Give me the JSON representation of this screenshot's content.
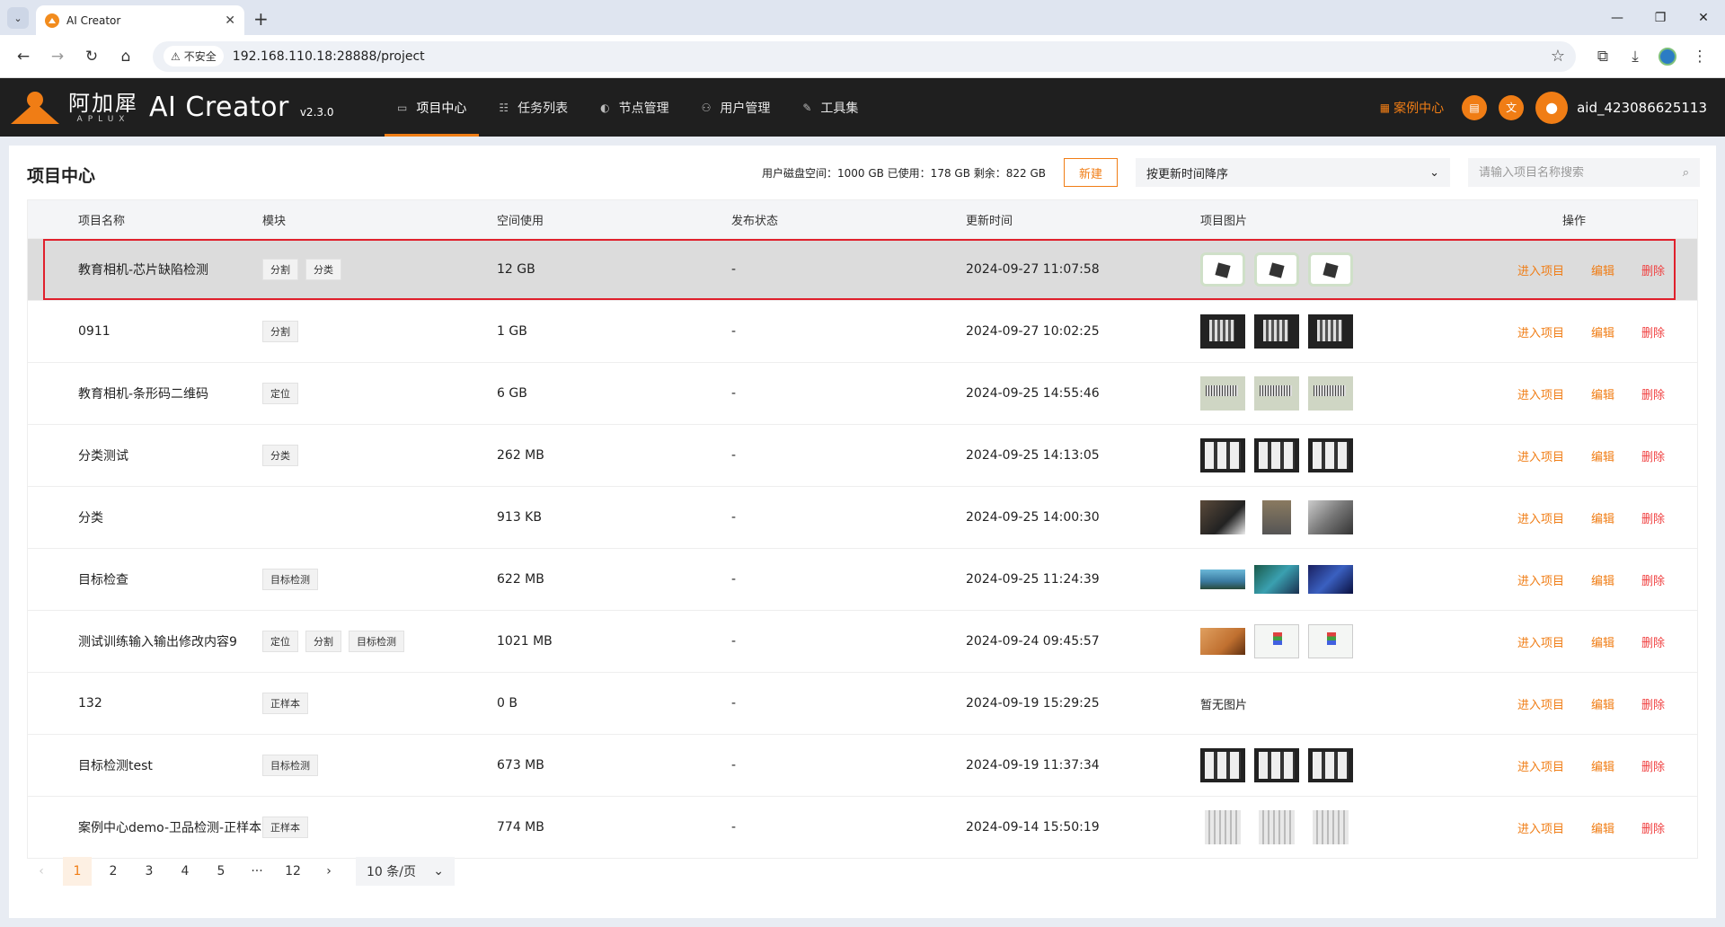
{
  "browser": {
    "tab_title": "AI Creator",
    "insecure_label": "不安全",
    "url": "192.168.110.18:28888/project"
  },
  "app": {
    "logo_cn": "阿加犀",
    "logo_en": "APLUX",
    "name": "AI Creator",
    "version": "v2.3.0",
    "nav": [
      {
        "label": "项目中心",
        "icon": "project-icon"
      },
      {
        "label": "任务列表",
        "icon": "list-icon"
      },
      {
        "label": "节点管理",
        "icon": "node-icon"
      },
      {
        "label": "用户管理",
        "icon": "users-icon"
      },
      {
        "label": "工具集",
        "icon": "tool-icon"
      }
    ],
    "case_center": "案例中心",
    "user": "aid_423086625113"
  },
  "page": {
    "title": "项目中心",
    "disk_info": "用户磁盘空间：1000 GB 已使用：178 GB 剩余：822 GB",
    "new_button": "新建",
    "sort_value": "按更新时间降序",
    "search_placeholder": "请输入项目名称搜索"
  },
  "table": {
    "headers": [
      "项目名称",
      "模块",
      "空间使用",
      "发布状态",
      "更新时间",
      "项目图片",
      "操作"
    ],
    "ops": {
      "enter": "进入项目",
      "edit": "编辑",
      "delete": "删除"
    },
    "no_image": "暂无图片",
    "rows": [
      {
        "name": "教育相机-芯片缺陷检测",
        "modules": [
          "分割",
          "分类"
        ],
        "space": "12 GB",
        "status": "-",
        "time": "2024-09-27 11:07:58",
        "thumb": "t-chip",
        "selected": true
      },
      {
        "name": "0911",
        "modules": [
          "分割"
        ],
        "space": "1 GB",
        "status": "-",
        "time": "2024-09-27 10:02:25",
        "thumb": "t-dark"
      },
      {
        "name": "教育相机-条形码二维码",
        "modules": [
          "定位"
        ],
        "space": "6 GB",
        "status": "-",
        "time": "2024-09-25 14:55:46",
        "thumb": "t-bar"
      },
      {
        "name": "分类测试",
        "modules": [
          "分类"
        ],
        "space": "262 MB",
        "status": "-",
        "time": "2024-09-25 14:13:05",
        "thumb": "t-sw"
      },
      {
        "name": "分类",
        "modules": [],
        "space": "913 KB",
        "status": "-",
        "time": "2024-09-25 14:00:30",
        "thumb": "cats"
      },
      {
        "name": "目标检查",
        "modules": [
          "目标检测"
        ],
        "space": "622 MB",
        "status": "-",
        "time": "2024-09-25 11:24:39",
        "thumb": "games"
      },
      {
        "name": "测试训练输入输出修改内容9",
        "modules": [
          "定位",
          "分割",
          "目标检测"
        ],
        "space": "1021 MB",
        "status": "-",
        "time": "2024-09-24 09:45:57",
        "thumb": "mixed"
      },
      {
        "name": "132",
        "modules": [
          "正样本"
        ],
        "space": "0 B",
        "status": "-",
        "time": "2024-09-19 15:29:25",
        "thumb": "none"
      },
      {
        "name": "目标检测test",
        "modules": [
          "目标检测"
        ],
        "space": "673 MB",
        "status": "-",
        "time": "2024-09-19 11:37:34",
        "thumb": "t-sw"
      },
      {
        "name": "案例中心demo-卫品检测-正样本",
        "modules": [
          "正样本"
        ],
        "space": "774 MB",
        "status": "-",
        "time": "2024-09-14 15:50:19",
        "thumb": "t-cloth"
      }
    ]
  },
  "pager": {
    "prev": "‹",
    "pages": [
      "1",
      "2",
      "3",
      "4",
      "5",
      "···",
      "12"
    ],
    "next": "›",
    "current": "1",
    "size": "10 条/页"
  }
}
